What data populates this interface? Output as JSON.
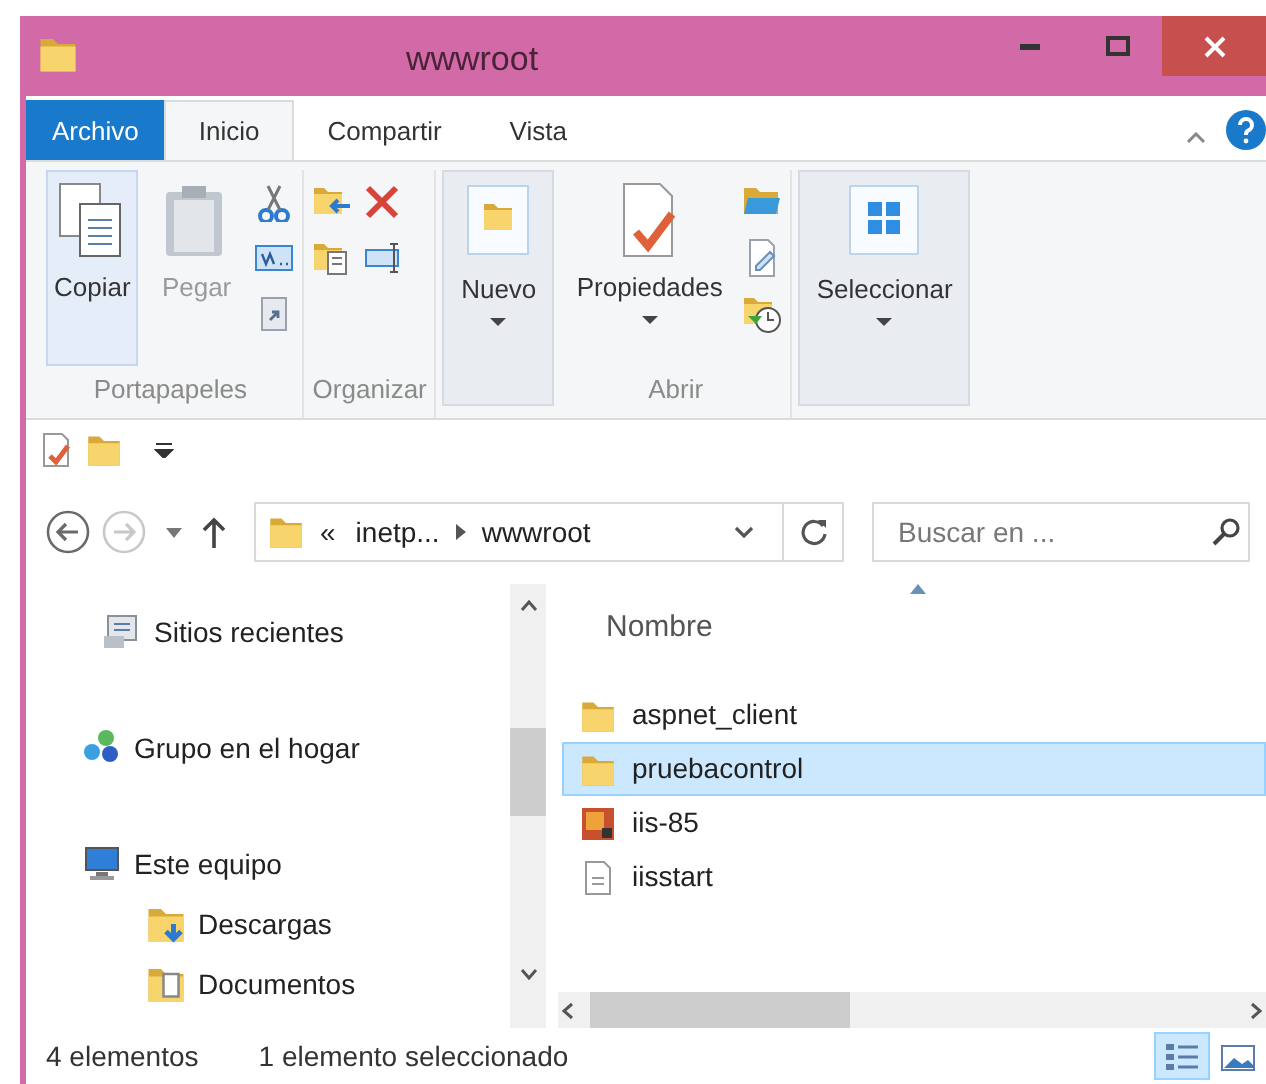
{
  "window": {
    "title": "wwwroot"
  },
  "ribbon_tabs": [
    {
      "label": "Archivo",
      "kind": "file",
      "selected": false
    },
    {
      "label": "Inicio",
      "kind": "tab",
      "selected": true
    },
    {
      "label": "Compartir",
      "kind": "tab",
      "selected": false
    },
    {
      "label": "Vista",
      "kind": "tab",
      "selected": false
    }
  ],
  "ribbon_groups": [
    {
      "label": "Portapapeles",
      "collapsed": false,
      "buttons": [
        {
          "label": "Copiar",
          "disabled": false,
          "hovered": true,
          "dropdown": false
        },
        {
          "label": "Pegar",
          "disabled": true,
          "hovered": false,
          "dropdown": false
        }
      ]
    },
    {
      "label": "Organizar",
      "collapsed": false
    },
    {
      "collapsed": true,
      "buttons": [
        {
          "label": "Nuevo",
          "disabled": false,
          "hovered": false,
          "dropdown": true
        }
      ]
    },
    {
      "label": "Abrir",
      "collapsed": false,
      "buttons": [
        {
          "label": "Propiedades",
          "disabled": false,
          "hovered": false,
          "dropdown": true
        }
      ]
    },
    {
      "collapsed": true,
      "buttons": [
        {
          "label": "Seleccionar",
          "disabled": false,
          "hovered": false,
          "dropdown": true
        }
      ]
    }
  ],
  "address_bar": {
    "back_disabled": false,
    "forward_disabled": true,
    "path": [
      {
        "label": "«",
        "kind": "overflow"
      },
      {
        "label": "inetp...",
        "kind": "segment"
      },
      {
        "label": "wwwroot",
        "kind": "segment"
      }
    ]
  },
  "search": {
    "placeholder": "Buscar en ..."
  },
  "nav_pane": [
    {
      "label": "Sitios recientes",
      "kind": "recent"
    },
    {
      "label": "Grupo en el hogar",
      "kind": "homegroup"
    },
    {
      "label": "Este equipo",
      "kind": "computer",
      "children": [
        {
          "label": "Descargas",
          "kind": "downloads"
        },
        {
          "label": "Documentos",
          "kind": "documents"
        }
      ]
    }
  ],
  "file_list": {
    "columns": [
      "Nombre"
    ],
    "rows": [
      {
        "name": "aspnet_client",
        "kind": "folder",
        "selected": false
      },
      {
        "name": "pruebacontrol",
        "kind": "folder",
        "selected": true
      },
      {
        "name": "iis-85",
        "kind": "image",
        "selected": false
      },
      {
        "name": "iisstart",
        "kind": "document",
        "selected": false
      }
    ]
  },
  "status_bar": {
    "item_count": "4 elementos",
    "selection": "1 elemento seleccionado",
    "views": [
      {
        "kind": "details",
        "selected": true
      },
      {
        "kind": "thumbnails",
        "selected": false
      }
    ]
  }
}
